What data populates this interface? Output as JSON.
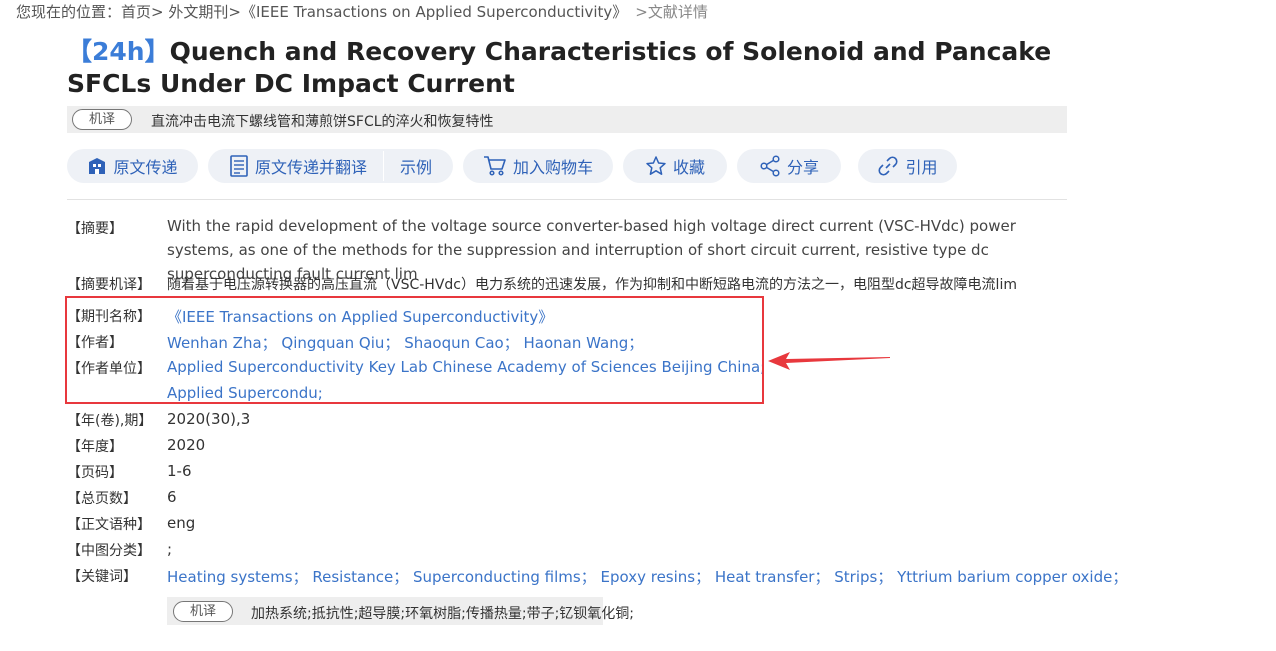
{
  "breadcrumb": {
    "prefix": "您现在的位置：",
    "home": "首页",
    "sep": ">",
    "category": "外文期刊",
    "journal": "《IEEE Transactions on Applied Superconductivity》",
    "current": ">文献详情"
  },
  "title": {
    "tag": "【24h】",
    "text": "Quench and Recovery Characteristics of Solenoid and Pancake SFCLs Under DC Impact Current"
  },
  "translation": {
    "badge": "机译",
    "text": "直流冲击电流下螺线管和薄煎饼SFCL的淬火和恢复特性"
  },
  "toolbar": {
    "delivery": "原文传递",
    "delivery_translate": "原文传递并翻译",
    "example": "示例",
    "cart": "加入购物车",
    "favorite": "收藏",
    "share": "分享",
    "cite": "引用"
  },
  "details": {
    "abstract_label": "【摘要】",
    "abstract": "With the rapid development of the voltage source converter-based high voltage direct current (VSC-HVdc) power systems, as one of the methods for the suppression and interruption of short circuit current, resistive type dc superconducting fault current lim",
    "abstract_mt_label": "【摘要机译】",
    "abstract_mt": "随着基于电压源转换器的高压直流（VSC-HVdc）电力系统的迅速发展，作为抑制和中断短路电流的方法之一，电阻型dc超导故障电流lim",
    "journal_label": "【期刊名称】",
    "journal": "《IEEE Transactions on Applied Superconductivity》",
    "authors_label": "【作者】",
    "authors": [
      "Wenhan Zha；",
      "Qingquan Qiu；",
      "Shaoqun Cao；",
      "Haonan Wang；"
    ],
    "affiliation_label": "【作者单位】",
    "affiliations": [
      "Applied Superconductivity Key Lab Chinese Academy of Sciences Beijing China;",
      "Applied Supercondu;"
    ],
    "volume_label": "【年(卷),期】",
    "volume": "2020(30),3",
    "year_label": "【年度】",
    "year": "2020",
    "pages_label": "【页码】",
    "pages": "1-6",
    "total_pages_label": "【总页数】",
    "total_pages": "6",
    "language_label": "【正文语种】",
    "language": "eng",
    "clc_label": "【中图分类】",
    "clc": ";",
    "keywords_label": "【关键词】",
    "keywords": [
      "Heating systems；",
      "Resistance；",
      "Superconducting films；",
      "Epoxy resins；",
      "Heat transfer；",
      "Strips；",
      "Yttrium barium copper oxide；"
    ],
    "keywords_mt_badge": "机译",
    "keywords_mt": "加热系统;抵抗性;超导膜;环氧树脂;传播热量;带子;钇钡氧化铜;"
  },
  "colors": {
    "link": "#3b74c8",
    "accent": "#3b7dd8",
    "annotation": "#e8383d",
    "button_bg": "#eef1f6"
  }
}
